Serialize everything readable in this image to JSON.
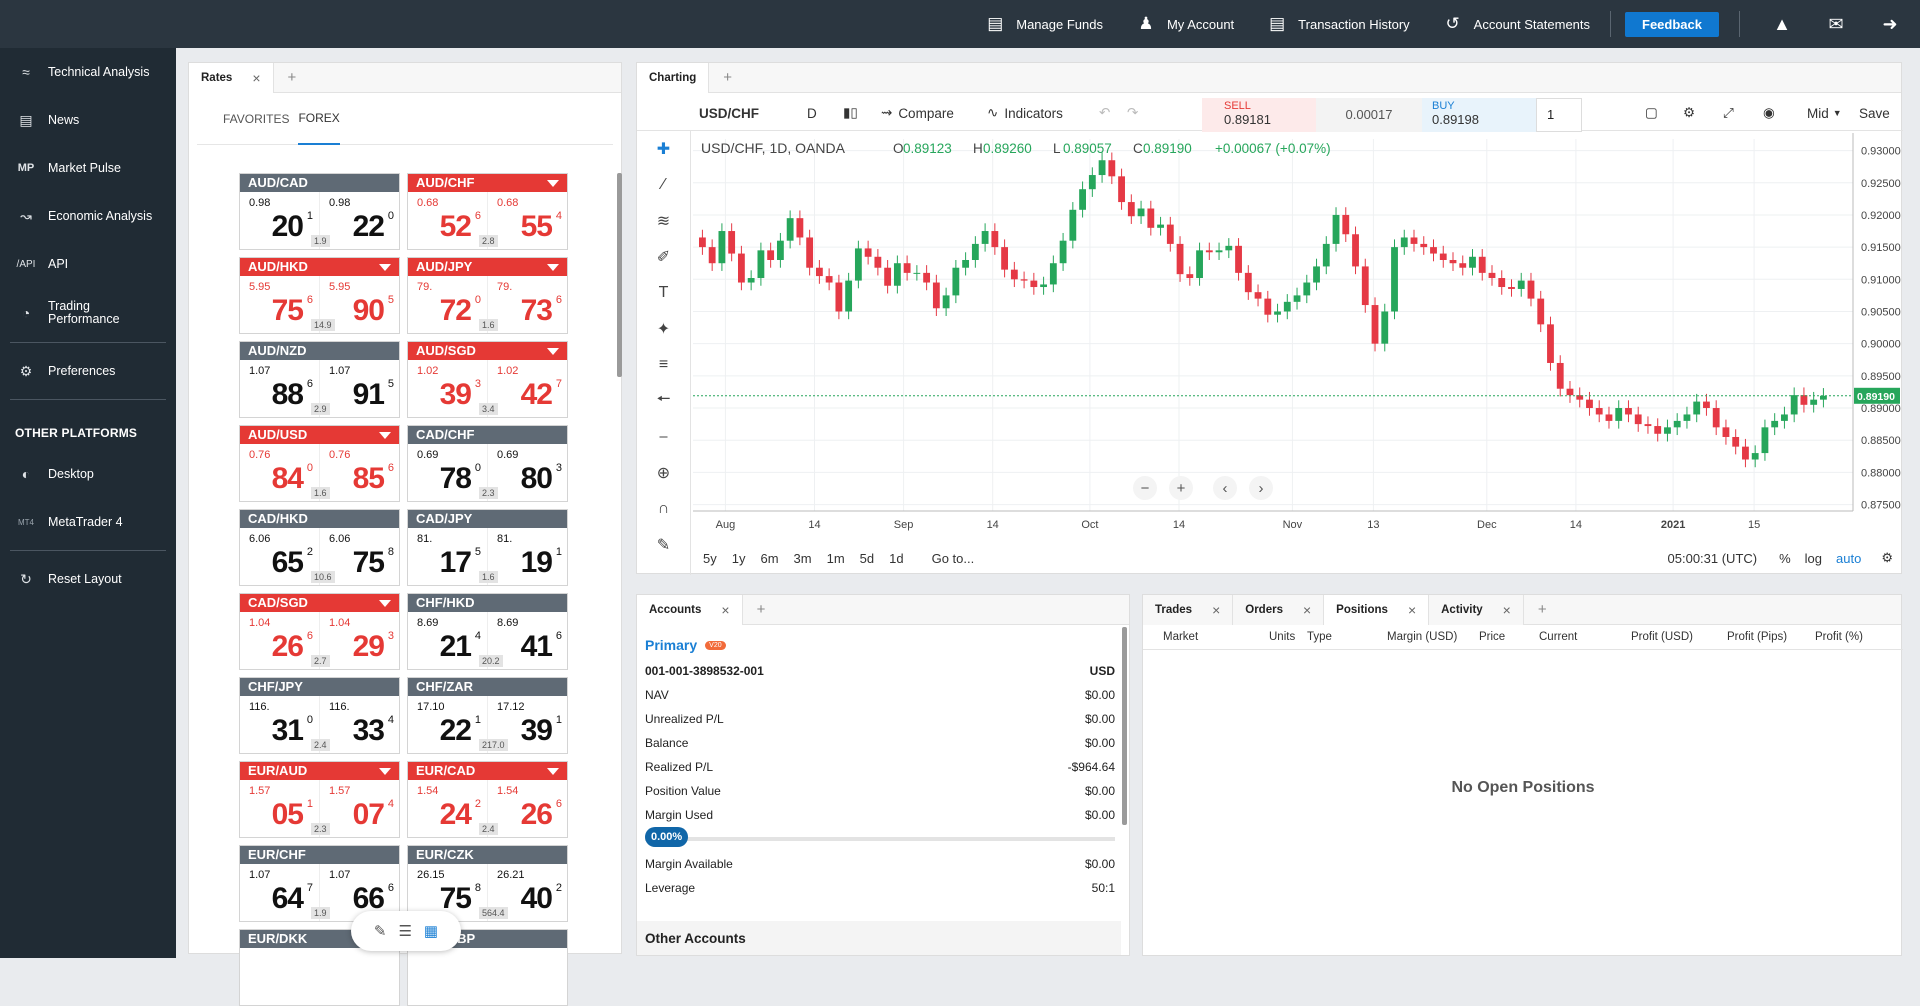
{
  "topbar": {
    "manage_funds": "Manage Funds",
    "my_account": "My Account",
    "transaction_history": "Transaction History",
    "account_statements": "Account Statements",
    "feedback": "Feedback"
  },
  "sidebar": {
    "items": [
      {
        "label": "Technical Analysis",
        "icon": "technical-analysis-icon"
      },
      {
        "label": "News",
        "icon": "news-icon"
      },
      {
        "label": "Market Pulse",
        "icon": "market-pulse-icon"
      },
      {
        "label": "Economic Analysis",
        "icon": "economic-analysis-icon"
      },
      {
        "label": "API",
        "icon": "api-icon"
      },
      {
        "label": "Trading Performance",
        "icon": "gauge-icon"
      }
    ],
    "preferences": "Preferences",
    "other_platforms_heading": "OTHER PLATFORMS",
    "platforms": [
      {
        "label": "Desktop"
      },
      {
        "label": "MetaTrader 4",
        "badge": "MT4"
      }
    ],
    "reset_layout": "Reset Layout"
  },
  "rates": {
    "tab": "Rates",
    "subtabs": [
      "FAVORITES",
      "FOREX"
    ],
    "tiles": [
      {
        "pair": "AUD/CAD",
        "color": "gray",
        "bid_pre": "0.98",
        "bid_big": "20",
        "bid_sup": "1",
        "ask_pre": "0.98",
        "ask_big": "22",
        "ask_sup": "0",
        "spread": "1.9"
      },
      {
        "pair": "AUD/CHF",
        "color": "red",
        "bid_pre": "0.68",
        "bid_big": "52",
        "bid_sup": "6",
        "ask_pre": "0.68",
        "ask_big": "55",
        "ask_sup": "4",
        "spread": "2.8"
      },
      {
        "pair": "AUD/HKD",
        "color": "red",
        "bid_pre": "5.95",
        "bid_big": "75",
        "bid_sup": "6",
        "ask_pre": "5.95",
        "ask_big": "90",
        "ask_sup": "5",
        "spread": "14.9"
      },
      {
        "pair": "AUD/JPY",
        "color": "red",
        "bid_pre": "79.",
        "bid_big": "72",
        "bid_sup": "0",
        "ask_pre": "79.",
        "ask_big": "73",
        "ask_sup": "6",
        "spread": "1.6"
      },
      {
        "pair": "AUD/NZD",
        "color": "gray",
        "bid_pre": "1.07",
        "bid_big": "88",
        "bid_sup": "6",
        "ask_pre": "1.07",
        "ask_big": "91",
        "ask_sup": "5",
        "spread": "2.9"
      },
      {
        "pair": "AUD/SGD",
        "color": "red",
        "bid_pre": "1.02",
        "bid_big": "39",
        "bid_sup": "3",
        "ask_pre": "1.02",
        "ask_big": "42",
        "ask_sup": "7",
        "spread": "3.4"
      },
      {
        "pair": "AUD/USD",
        "color": "red",
        "bid_pre": "0.76",
        "bid_big": "84",
        "bid_sup": "0",
        "ask_pre": "0.76",
        "ask_big": "85",
        "ask_sup": "6",
        "spread": "1.6"
      },
      {
        "pair": "CAD/CHF",
        "color": "gray",
        "bid_pre": "0.69",
        "bid_big": "78",
        "bid_sup": "0",
        "ask_pre": "0.69",
        "ask_big": "80",
        "ask_sup": "3",
        "spread": "2.3"
      },
      {
        "pair": "CAD/HKD",
        "color": "gray",
        "bid_pre": "6.06",
        "bid_big": "65",
        "bid_sup": "2",
        "ask_pre": "6.06",
        "ask_big": "75",
        "ask_sup": "8",
        "spread": "10.6"
      },
      {
        "pair": "CAD/JPY",
        "color": "gray",
        "bid_pre": "81.",
        "bid_big": "17",
        "bid_sup": "5",
        "ask_pre": "81.",
        "ask_big": "19",
        "ask_sup": "1",
        "spread": "1.6"
      },
      {
        "pair": "CAD/SGD",
        "color": "red",
        "bid_pre": "1.04",
        "bid_big": "26",
        "bid_sup": "6",
        "ask_pre": "1.04",
        "ask_big": "29",
        "ask_sup": "3",
        "spread": "2.7"
      },
      {
        "pair": "CHF/HKD",
        "color": "gray",
        "bid_pre": "8.69",
        "bid_big": "21",
        "bid_sup": "4",
        "ask_pre": "8.69",
        "ask_big": "41",
        "ask_sup": "6",
        "spread": "20.2"
      },
      {
        "pair": "CHF/JPY",
        "color": "gray",
        "bid_pre": "116.",
        "bid_big": "31",
        "bid_sup": "0",
        "ask_pre": "116.",
        "ask_big": "33",
        "ask_sup": "4",
        "spread": "2.4"
      },
      {
        "pair": "CHF/ZAR",
        "color": "gray",
        "bid_pre": "17.10",
        "bid_big": "22",
        "bid_sup": "1",
        "ask_pre": "17.12",
        "ask_big": "39",
        "ask_sup": "1",
        "spread": "217.0"
      },
      {
        "pair": "EUR/AUD",
        "color": "red",
        "bid_pre": "1.57",
        "bid_big": "05",
        "bid_sup": "1",
        "ask_pre": "1.57",
        "ask_big": "07",
        "ask_sup": "4",
        "spread": "2.3"
      },
      {
        "pair": "EUR/CAD",
        "color": "red",
        "bid_pre": "1.54",
        "bid_big": "24",
        "bid_sup": "2",
        "ask_pre": "1.54",
        "ask_big": "26",
        "ask_sup": "6",
        "spread": "2.4"
      },
      {
        "pair": "EUR/CHF",
        "color": "gray",
        "bid_pre": "1.07",
        "bid_big": "64",
        "bid_sup": "7",
        "ask_pre": "1.07",
        "ask_big": "66",
        "ask_sup": "6",
        "spread": "1.9"
      },
      {
        "pair": "EUR/CZK",
        "color": "gray",
        "bid_pre": "26.15",
        "bid_big": "75",
        "bid_sup": "8",
        "ask_pre": "26.21",
        "ask_big": "40",
        "ask_sup": "2",
        "spread": "564.4"
      },
      {
        "pair": "EUR/DKK",
        "color": "gray"
      },
      {
        "pair": "EUR/GBP",
        "color": "gray"
      }
    ]
  },
  "chart": {
    "tab": "Charting",
    "symbol": "USD/CHF",
    "interval": "D",
    "compare": "Compare",
    "indicators": "Indicators",
    "sell_label": "SELL",
    "sell_price": "0.89181",
    "spread": "0.00017",
    "buy_label": "BUY",
    "buy_price": "0.89198",
    "quantity": "1",
    "price_type": "Mid",
    "save": "Save",
    "legend": {
      "title": "USD/CHF, 1D, OANDA",
      "o": "0.89123",
      "h": "0.89260",
      "l": "0.89057",
      "c": "0.89190",
      "change": "+0.00067 (+0.07%)"
    },
    "ranges": [
      "5y",
      "1y",
      "6m",
      "3m",
      "1m",
      "5d",
      "1d"
    ],
    "goto": "Go to...",
    "clock": "05:00:31 (UTC)",
    "scale_opts": [
      "%",
      "log",
      "auto"
    ],
    "last_price_tag": "0.89190"
  },
  "chart_data": {
    "type": "candlestick",
    "title": "USD/CHF, 1D, OANDA",
    "x_ticks": [
      "Aug",
      "14",
      "Sep",
      "14",
      "Oct",
      "14",
      "Nov",
      "13",
      "Dec",
      "14",
      "2021",
      "15"
    ],
    "y_ticks": [
      "0.93000",
      "0.92500",
      "0.92000",
      "0.91500",
      "0.91000",
      "0.90500",
      "0.90000",
      "0.89500",
      "0.89000",
      "0.88500",
      "0.88000",
      "0.87500"
    ],
    "ylim": [
      0.874,
      0.9318
    ],
    "close": [
      0.915,
      0.9125,
      0.9175,
      0.914,
      0.9095,
      0.9102,
      0.9145,
      0.913,
      0.916,
      0.9195,
      0.9165,
      0.9118,
      0.9105,
      0.9095,
      0.905,
      0.9098,
      0.9148,
      0.9135,
      0.9118,
      0.909,
      0.9125,
      0.911,
      0.911,
      0.9095,
      0.9055,
      0.9075,
      0.9118,
      0.913,
      0.9155,
      0.9175,
      0.915,
      0.9115,
      0.91,
      0.9098,
      0.9088,
      0.9092,
      0.9125,
      0.916,
      0.9208,
      0.924,
      0.9262,
      0.9285,
      0.926,
      0.922,
      0.9198,
      0.921,
      0.918,
      0.9185,
      0.9155,
      0.9108,
      0.9102,
      0.9145,
      0.9142,
      0.9145,
      0.9152,
      0.911,
      0.908,
      0.907,
      0.9045,
      0.905,
      0.9065,
      0.9075,
      0.9095,
      0.912,
      0.9155,
      0.92,
      0.917,
      0.912,
      0.906,
      0.9,
      0.905,
      0.915,
      0.9165,
      0.9155,
      0.915,
      0.914,
      0.913,
      0.9125,
      0.9118,
      0.9135,
      0.911,
      0.9102,
      0.9088,
      0.9085,
      0.9098,
      0.907,
      0.903,
      0.897,
      0.893,
      0.892,
      0.8913,
      0.89,
      0.889,
      0.888,
      0.89,
      0.889,
      0.8875,
      0.8872,
      0.886,
      0.887,
      0.888,
      0.889,
      0.891,
      0.89,
      0.887,
      0.8855,
      0.884,
      0.882,
      0.883,
      0.887,
      0.888,
      0.889,
      0.892,
      0.8905,
      0.8913,
      0.8919
    ],
    "last_price": 0.8919
  },
  "accounts": {
    "tab": "Accounts",
    "name": "Primary",
    "badge": "V20",
    "id": "001-001-3898532-001",
    "currency": "USD",
    "rows": [
      {
        "label": "NAV",
        "value": "$0.00"
      },
      {
        "label": "Unrealized P/L",
        "value": "$0.00"
      },
      {
        "label": "Balance",
        "value": "$0.00"
      },
      {
        "label": "Realized P/L",
        "value": "-$964.64"
      },
      {
        "label": "Position Value",
        "value": "$0.00"
      },
      {
        "label": "Margin Used",
        "value": "$0.00"
      }
    ],
    "margin_pct": "0.00%",
    "margin_fraction": 0.0,
    "rows2": [
      {
        "label": "Margin Available",
        "value": "$0.00"
      },
      {
        "label": "Leverage",
        "value": "50:1"
      }
    ],
    "other": "Other Accounts"
  },
  "positions": {
    "tabs": [
      "Trades",
      "Orders",
      "Positions",
      "Activity"
    ],
    "columns": [
      "Market",
      "Units",
      "Type",
      "Margin (USD)",
      "Price",
      "Current",
      "Profit (USD)",
      "Profit (Pips)",
      "Profit (%)"
    ],
    "empty": "No Open Positions"
  }
}
